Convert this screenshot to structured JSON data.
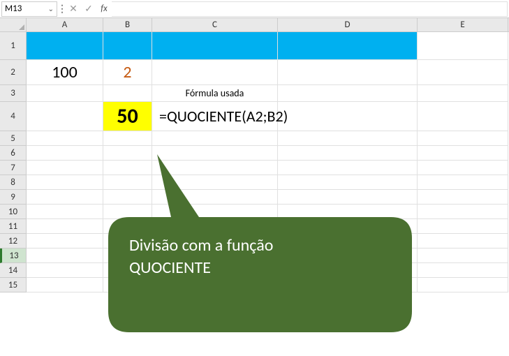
{
  "formula_bar": {
    "name_box": "M13",
    "formula_value": ""
  },
  "columns": [
    "A",
    "B",
    "C",
    "D",
    "E"
  ],
  "rows": [
    "1",
    "2",
    "3",
    "4",
    "5",
    "6",
    "7",
    "8",
    "9",
    "10",
    "11",
    "12",
    "13",
    "14",
    "15"
  ],
  "cells": {
    "a2": "100",
    "b2": "2",
    "c3": "Fórmula usada",
    "b4": "50",
    "c4": "=QUOCIENTE(A2;B2)"
  },
  "callout": {
    "line1": "Divisão com a função",
    "line2": "QUOCIENTE"
  },
  "colors": {
    "blue_fill": "#00b0f0",
    "yellow_fill": "#ffff00",
    "callout_fill": "#4a7030",
    "orange_text": "#c55a11"
  },
  "icons": {
    "chevron": "⌄",
    "cancel": "✕",
    "enter": "✓",
    "fx": "fx"
  }
}
